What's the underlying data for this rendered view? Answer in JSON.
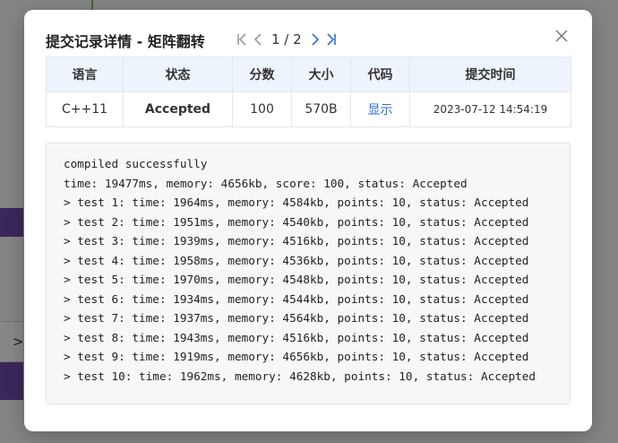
{
  "colors": {
    "accent": "#2f6fcf",
    "accepted": "#2e8b2e",
    "header_bg": "#eef4fc",
    "log_bg": "#f7f7f7"
  },
  "background_page": {
    "chevron_icon": "chevron-right-icon"
  },
  "modal": {
    "title": "提交记录详情 - 矩阵翻转",
    "pager": {
      "current": 1,
      "total": 2,
      "indicator": "1 / 2",
      "icons": [
        "first-page-icon",
        "prev-page-icon",
        "next-page-icon",
        "last-page-icon"
      ]
    },
    "close_icon": "close-icon"
  },
  "submission": {
    "headers": [
      "语言",
      "状态",
      "分数",
      "大小",
      "代码",
      "提交时间"
    ],
    "row": {
      "language": "C++11",
      "status": "Accepted",
      "score": "100",
      "size": "570B",
      "code_link": "显示",
      "submit_time": "2023-07-12 14:54:19"
    }
  },
  "log": [
    "compiled successfully",
    "time: 19477ms, memory: 4656kb, score: 100, status: Accepted",
    "> test 1: time: 1964ms, memory: 4584kb, points: 10, status: Accepted",
    "> test 2: time: 1951ms, memory: 4540kb, points: 10, status: Accepted",
    "> test 3: time: 1939ms, memory: 4516kb, points: 10, status: Accepted",
    "> test 4: time: 1958ms, memory: 4536kb, points: 10, status: Accepted",
    "> test 5: time: 1970ms, memory: 4548kb, points: 10, status: Accepted",
    "> test 6: time: 1934ms, memory: 4544kb, points: 10, status: Accepted",
    "> test 7: time: 1937ms, memory: 4564kb, points: 10, status: Accepted",
    "> test 8: time: 1943ms, memory: 4516kb, points: 10, status: Accepted",
    "> test 9: time: 1919ms, memory: 4656kb, points: 10, status: Accepted",
    "> test 10: time: 1962ms, memory: 4628kb, points: 10, status: Accepted"
  ]
}
